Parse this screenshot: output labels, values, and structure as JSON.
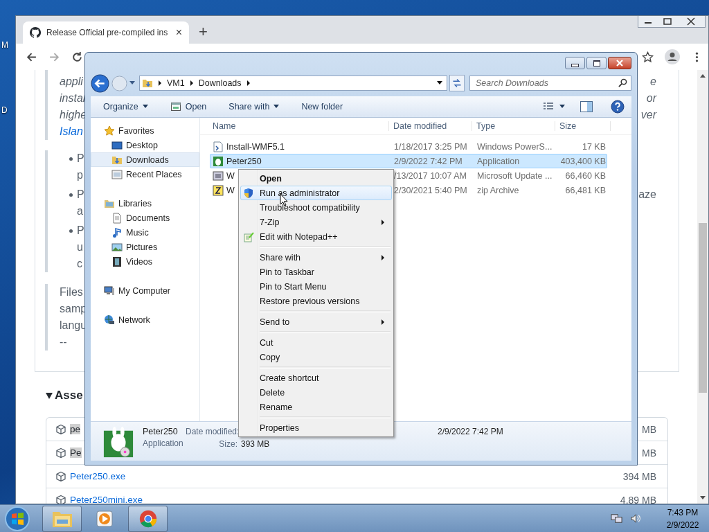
{
  "desktop": {
    "icon_labels": [
      {
        "text": "M"
      },
      {
        "text": "D"
      }
    ]
  },
  "browser": {
    "tab": {
      "title": "Release Official pre-compiled ins",
      "close": "×",
      "selected": true
    },
    "new_tab": "+",
    "page": {
      "blocks": [
        {
          "kind": "quote",
          "lines": [
            {
              "text": "appli",
              "kind": "emphasis",
              "right": "e"
            },
            {
              "text": "instal",
              "kind": "emphasis",
              "right": "or"
            },
            {
              "text": "highe",
              "kind": "emphasis",
              "right": "ver"
            },
            {
              "text": "Islan",
              "kind": "link"
            }
          ]
        },
        {
          "kind": "list",
          "items": [
            {
              "lines": [
                {
                  "text": "P"
                },
                {
                  "text": "p"
                }
              ]
            },
            {
              "lines": [
                {
                  "text": "P",
                  "right": "aze"
                },
                {
                  "text": "a"
                }
              ]
            },
            {
              "lines": [
                {
                  "text": "P"
                },
                {
                  "text": "u"
                },
                {
                  "text": "c"
                }
              ]
            }
          ]
        },
        {
          "kind": "quote",
          "lines": [
            {
              "text": "Files"
            },
            {
              "text": "samp"
            },
            {
              "text": "langu"
            },
            {
              "text": "--"
            }
          ]
        }
      ],
      "assets": {
        "heading": "Asse",
        "expanded": true,
        "rows": [
          {
            "name": "pe",
            "size": "MB",
            "highlighted": true
          },
          {
            "name": "Pe",
            "size": "MB",
            "highlighted": true
          },
          {
            "name": "Peter250.exe",
            "size": "394 MB",
            "highlighted": false
          },
          {
            "name": "Peter250mini.exe",
            "size": "4.89 MB",
            "highlighted": false
          }
        ]
      }
    }
  },
  "explorer": {
    "breadcrumb": [
      "VM1",
      "Downloads"
    ],
    "search": {
      "placeholder": "Search Downloads"
    },
    "toolbar": [
      {
        "label": "Organize",
        "dropdown": true,
        "kind": "text"
      },
      {
        "label": "Open",
        "dropdown": false,
        "kind": "with-icon"
      },
      {
        "label": "Share with",
        "dropdown": true,
        "kind": "text"
      },
      {
        "label": "New folder",
        "dropdown": false,
        "kind": "text"
      }
    ],
    "nav": [
      {
        "label": "Favorites",
        "selected": false,
        "children": [
          {
            "label": "Desktop",
            "selected": false
          },
          {
            "label": "Downloads",
            "selected": true
          },
          {
            "label": "Recent Places",
            "selected": false
          }
        ]
      },
      {
        "label": "Libraries",
        "selected": false,
        "children": [
          {
            "label": "Documents",
            "selected": false
          },
          {
            "label": "Music",
            "selected": false
          },
          {
            "label": "Pictures",
            "selected": false
          },
          {
            "label": "Videos",
            "selected": false
          }
        ]
      },
      {
        "label": "My Computer",
        "selected": false
      },
      {
        "label": "Network",
        "selected": false
      }
    ],
    "columns": [
      "Name",
      "Date modified",
      "Type",
      "Size"
    ],
    "files": [
      {
        "name": "Install-WMF5.1",
        "date": "1/18/2017 3:25 PM",
        "type": "Windows PowerS...",
        "size": "17 KB",
        "selected": false
      },
      {
        "name": "Peter250",
        "date": "2/9/2022 7:42 PM",
        "type": "Application",
        "size": "403,400 KB",
        "selected": true
      },
      {
        "name": "W",
        "date": "/13/2017 10:07 AM",
        "type": "Microsoft Update ...",
        "size": "66,460 KB",
        "selected": false
      },
      {
        "name": "W",
        "date": "2/30/2021 5:40 PM",
        "type": "zip Archive",
        "size": "66,481 KB",
        "selected": false
      }
    ],
    "details": {
      "name": "Peter250",
      "type": "Application",
      "date_modified_label": "Date modified:",
      "size_label": "Size:",
      "size": "393 MB",
      "date_created": "2/9/2022 7:42 PM"
    }
  },
  "context_menu": {
    "items": [
      {
        "kind": "item",
        "label": "Open",
        "default": true,
        "highlighted": false,
        "submenu": false
      },
      {
        "kind": "item",
        "label": "Run as administrator",
        "default": false,
        "highlighted": true,
        "submenu": false
      },
      {
        "kind": "item",
        "label": "Troubleshoot compatibility",
        "default": false,
        "highlighted": false,
        "submenu": false
      },
      {
        "kind": "item",
        "label": "7-Zip",
        "default": false,
        "highlighted": false,
        "submenu": true
      },
      {
        "kind": "item",
        "label": "Edit with Notepad++",
        "default": false,
        "highlighted": false,
        "submenu": false
      },
      {
        "kind": "separator"
      },
      {
        "kind": "item",
        "label": "Share with",
        "default": false,
        "highlighted": false,
        "submenu": true
      },
      {
        "kind": "item",
        "label": "Pin to Taskbar",
        "default": false,
        "highlighted": false,
        "submenu": false
      },
      {
        "kind": "item",
        "label": "Pin to Start Menu",
        "default": false,
        "highlighted": false,
        "submenu": false
      },
      {
        "kind": "item",
        "label": "Restore previous versions",
        "default": false,
        "highlighted": false,
        "submenu": false
      },
      {
        "kind": "separator"
      },
      {
        "kind": "item",
        "label": "Send to",
        "default": false,
        "highlighted": false,
        "submenu": true
      },
      {
        "kind": "separator"
      },
      {
        "kind": "item",
        "label": "Cut",
        "default": false,
        "highlighted": false,
        "submenu": false
      },
      {
        "kind": "item",
        "label": "Copy",
        "default": false,
        "highlighted": false,
        "submenu": false
      },
      {
        "kind": "separator"
      },
      {
        "kind": "item",
        "label": "Create shortcut",
        "default": false,
        "highlighted": false,
        "submenu": false
      },
      {
        "kind": "item",
        "label": "Delete",
        "default": false,
        "highlighted": false,
        "submenu": false
      },
      {
        "kind": "item",
        "label": "Rename",
        "default": false,
        "highlighted": false,
        "submenu": false
      },
      {
        "kind": "separator"
      },
      {
        "kind": "item",
        "label": "Properties",
        "default": false,
        "highlighted": false,
        "submenu": false
      }
    ]
  },
  "taskbar": {
    "apps": [
      {
        "running": true
      },
      {
        "running": false
      },
      {
        "running": true
      }
    ],
    "clock": {
      "time": "7:43 PM",
      "date": "2/9/2022"
    }
  }
}
